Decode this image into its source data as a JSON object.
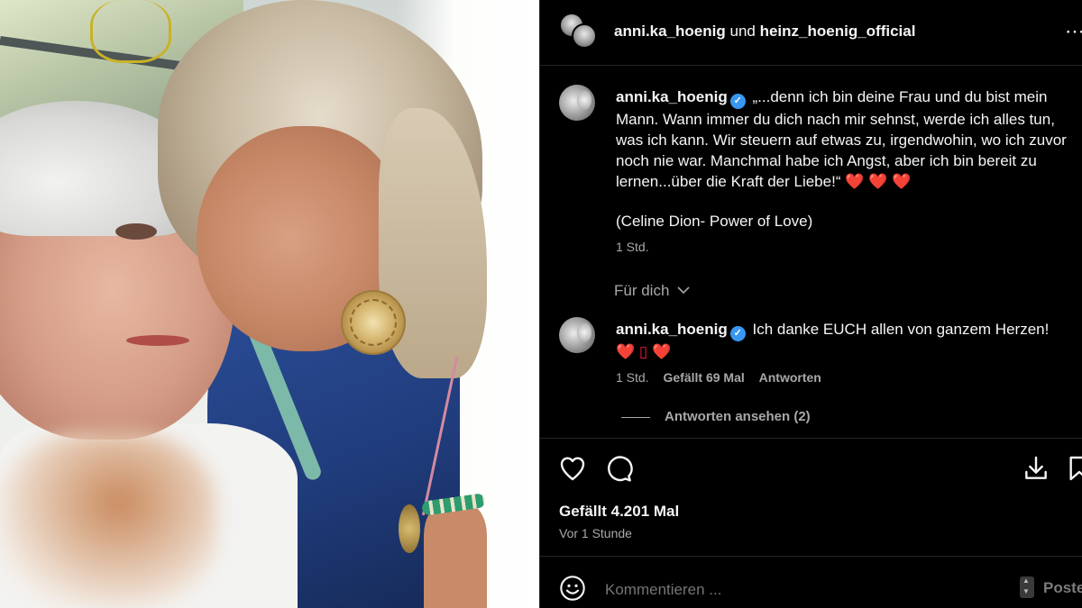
{
  "header": {
    "user1": "anni.ka_hoenig",
    "conjunction": "und",
    "user2": "heinz_hoenig_official",
    "more_icon": "more-icon"
  },
  "comments": [
    {
      "username": "anni.ka_hoenig",
      "verified": true,
      "text": "„...denn ich bin deine Frau und du bist mein Mann. Wann immer du dich nach mir sehnst, werde ich alles tun, was ich kann. Wir steuern auf etwas zu, irgendwohin, wo ich zuvor noch nie war. Manchmal habe ich Angst, aber ich bin bereit zu lernen...über die Kraft der Liebe!“",
      "hearts": "❤️ ❤️ ❤️",
      "extra": "(Celine Dion- Power of Love)",
      "time": "1 Std."
    },
    {
      "username": "anni.ka_hoenig",
      "verified": true,
      "text": "Ich danke EUCH allen von ganzem Herzen!",
      "hearts_line": "❤️ ▯ ❤️",
      "time": "1 Std.",
      "likes": "Gefällt 69 Mal",
      "reply": "Antworten",
      "view_replies": "Antworten ansehen (2)"
    }
  ],
  "for_you": "Für dich",
  "post": {
    "likes": "Gefällt 4.201 Mal",
    "time": "Vor 1 Stunde"
  },
  "composer": {
    "placeholder": "Kommentieren ...",
    "post_label": "Posten"
  },
  "colors": {
    "background": "#000000",
    "text": "#f5f5f5",
    "muted": "#a8a8a8",
    "verified": "#3897f0",
    "heart": "#ed1c3b"
  }
}
